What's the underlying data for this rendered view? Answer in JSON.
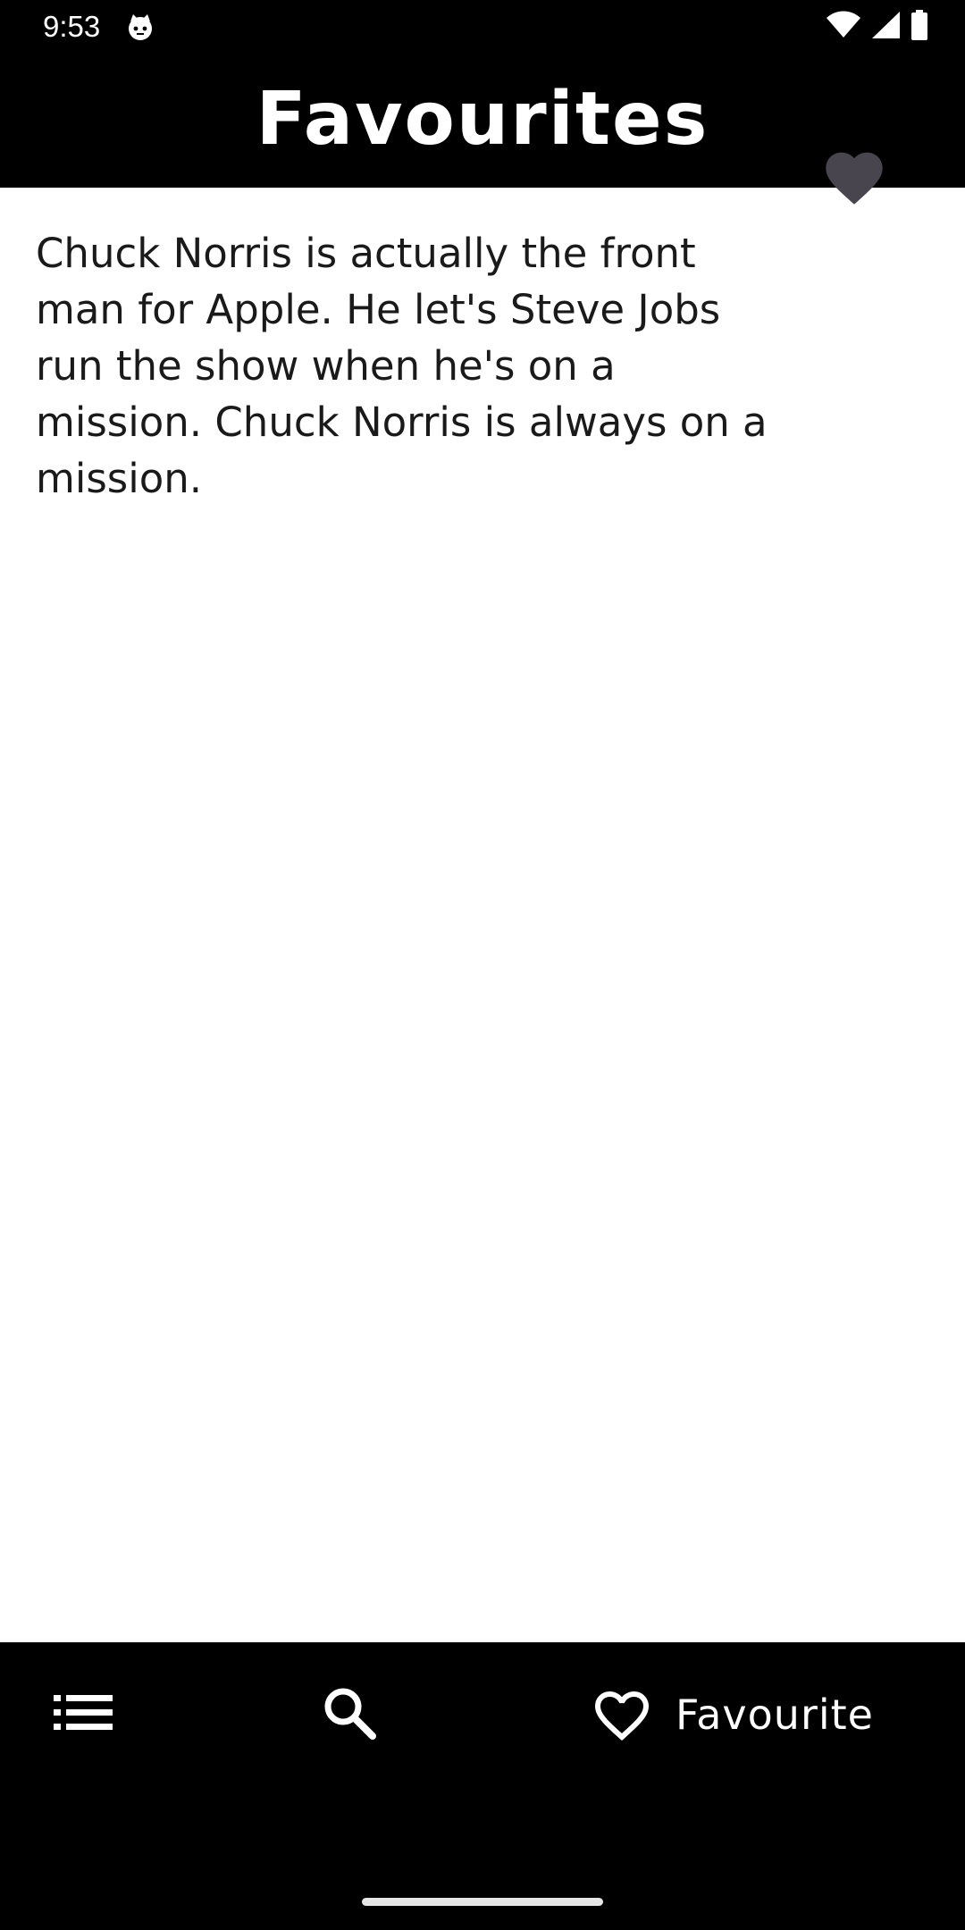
{
  "status_bar": {
    "time": "9:53",
    "app_icon": "cat-face-icon",
    "icons": [
      "wifi-icon",
      "cellular-signal-icon",
      "battery-icon"
    ]
  },
  "header": {
    "title": "Favourites"
  },
  "favourites": [
    {
      "text": "Chuck Norris is actually the front man for Apple. He let's Steve Jobs run the show when he's on a mission. Chuck Norris is always on a mission.",
      "icon": "heart-filled-icon"
    }
  ],
  "bottom_nav": {
    "items": [
      {
        "icon": "list-icon",
        "label": ""
      },
      {
        "icon": "search-icon",
        "label": ""
      },
      {
        "icon": "heart-outline-icon",
        "label": "Favourite"
      }
    ],
    "active_index": 2
  },
  "colors": {
    "background": "#000000",
    "content": "#ffffff",
    "text": "#1a1a1a",
    "heart": "#49454f",
    "nav_icon": "#ffffff"
  }
}
